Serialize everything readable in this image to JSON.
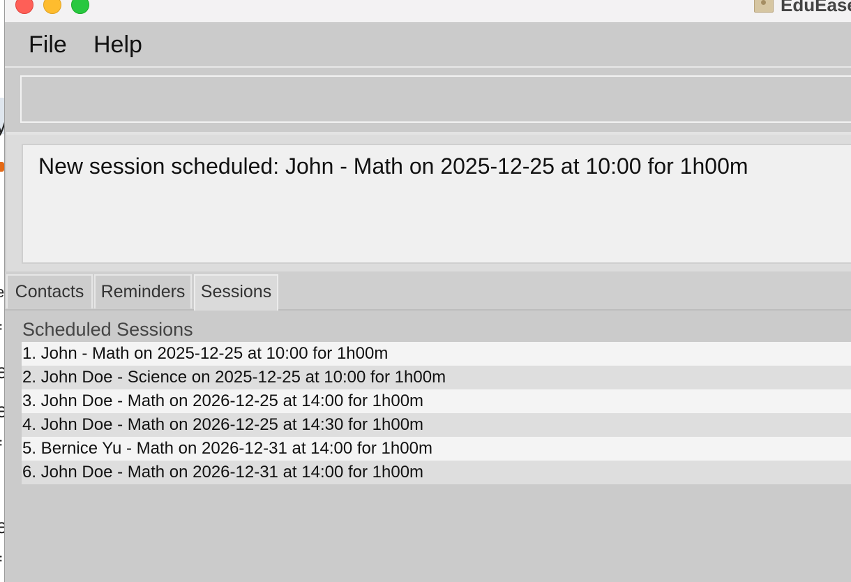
{
  "window": {
    "title": "EduEase"
  },
  "menu": {
    "file": "File",
    "help": "Help"
  },
  "command": {
    "value": ""
  },
  "result": {
    "message": "New session scheduled: John - Math on 2025-12-25 at 10:00 for 1h00m"
  },
  "tabs": [
    {
      "label": "Contacts"
    },
    {
      "label": "Reminders"
    },
    {
      "label": "Sessions"
    }
  ],
  "sessions": {
    "title": "Scheduled Sessions",
    "items": [
      "1. John - Math on 2025-12-25 at 10:00 for 1h00m",
      "2. John Doe - Science on 2025-12-25 at 10:00 for 1h00m",
      "3. John Doe - Math on 2026-12-25 at 14:00 for 1h00m",
      "4. John Doe - Math on 2026-12-25 at 14:30 for 1h00m",
      "5. Bernice Yu - Math on 2026-12-31 at 14:00 for 1h00m",
      "6. John Doe - Math on 2026-12-31 at 14:00 for 1h00m"
    ]
  },
  "background_window": {
    "letters": [
      "y",
      "e",
      "f",
      "e",
      "e",
      "f",
      "e",
      "f"
    ]
  }
}
